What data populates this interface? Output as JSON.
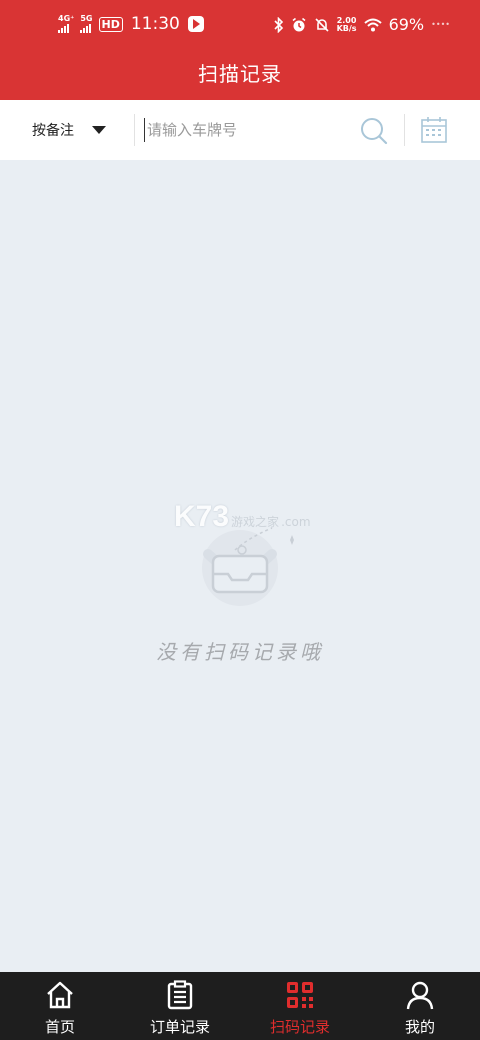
{
  "status_bar": {
    "sim1": "4G⁺",
    "sim2": "5G",
    "hd": "HD",
    "time": "11:30",
    "speed_value": "2.00",
    "speed_unit": "KB/s",
    "battery": "69%"
  },
  "header": {
    "title": "扫描记录"
  },
  "filter": {
    "select_label": "按备注",
    "search_placeholder": "请输入车牌号"
  },
  "empty_state": {
    "message": "没有扫码记录哦",
    "watermark_logo": "K73",
    "watermark_text": "游戏之家",
    "watermark_sub": ".com"
  },
  "bottom_nav": {
    "items": [
      {
        "label": "首页",
        "icon": "home-icon",
        "active": false
      },
      {
        "label": "订单记录",
        "icon": "clipboard-list-icon",
        "active": false
      },
      {
        "label": "扫码记录",
        "icon": "qr-scan-icon",
        "active": true
      },
      {
        "label": "我的",
        "icon": "user-icon",
        "active": false
      }
    ]
  },
  "colors": {
    "brand_red": "#d93434",
    "active_red": "#e02d2d",
    "page_bg": "#e9eef3",
    "nav_bg": "#1e1e1e",
    "icon_blue": "#a9c6d8"
  }
}
